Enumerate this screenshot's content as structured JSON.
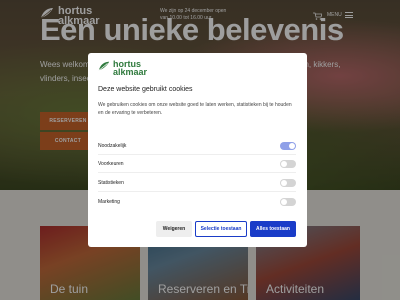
{
  "header": {
    "logo_line1": "hortus",
    "logo_line2": "alkmaar",
    "info_text": "We zijn op 24 december open van 10.00 tot 16.00 uur",
    "cart_icon": "cart-icon",
    "menu_label": "MENU",
    "menu_icon": "hamburger-icon"
  },
  "hero": {
    "title": "Een unieke belevenis",
    "intro": "Wees welkom in de hortus. Geniet van de mooiste bloemen, planten, vissen, kikkers, vlinders, insecten, bijen, vogels en veel meer van de ijsvogels.",
    "reserve_label": "RESERVEREN",
    "contact_label": "CONTACT"
  },
  "cards": [
    {
      "label": "De tuin"
    },
    {
      "label": "Reserveren en Tickets"
    },
    {
      "label": "Activiteiten"
    }
  ],
  "cookie_modal": {
    "logo_line1": "hortus",
    "logo_line2": "alkmaar",
    "title": "Deze website gebruikt cookies",
    "description": "We gebruiken cookies om onze website goed te laten werken, statistieken bij te houden en de ervaring te verbeteren.",
    "toggles": [
      {
        "label": "Noodzakelijk",
        "on": true
      },
      {
        "label": "Voorkeuren",
        "on": false
      },
      {
        "label": "Statistieken",
        "on": false
      },
      {
        "label": "Marketing",
        "on": false
      }
    ],
    "reject_label": "Weigeren",
    "select_label": "Selectie toestaan",
    "accept_all_label": "Alles toestaan"
  },
  "colors": {
    "brand_green": "#2f7a3d",
    "cta_orange": "#c8642a",
    "primary_blue": "#1a3cc8",
    "toggle_on": "#8fa0e8"
  }
}
